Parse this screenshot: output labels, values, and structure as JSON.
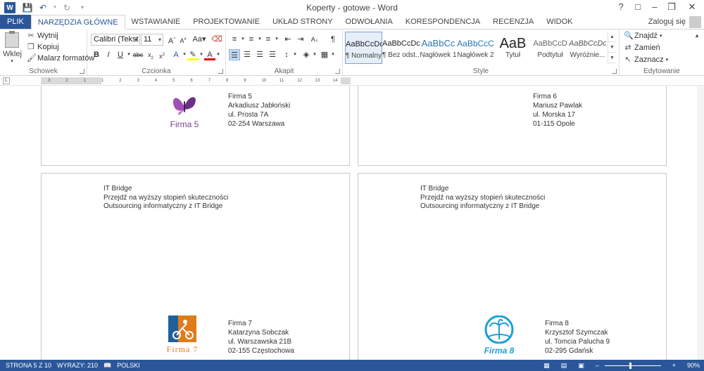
{
  "app": {
    "title": "Koperty - gotowe - Word",
    "signin": "Zaloguj się",
    "word_logo": "W"
  },
  "tabs": [
    {
      "label": "PLIK"
    },
    {
      "label": "NARZĘDZIA GŁÓWNE"
    },
    {
      "label": "WSTAWIANIE"
    },
    {
      "label": "PROJEKTOWANIE"
    },
    {
      "label": "UKŁAD STRONY"
    },
    {
      "label": "ODWOŁANIA"
    },
    {
      "label": "KORESPONDENCJA"
    },
    {
      "label": "RECENZJA"
    },
    {
      "label": "WIDOK"
    }
  ],
  "ribbon": {
    "clipboard": {
      "label": "Schowek",
      "paste": "Wklej",
      "cut": "Wytnij",
      "copy": "Kopiuj",
      "format_painter": "Malarz formatów"
    },
    "font": {
      "label": "Czcionka",
      "font_name": "Calibri (Tekst p",
      "font_size": "11"
    },
    "paragraph": {
      "label": "Akapit"
    },
    "styles": {
      "label": "Style",
      "items": [
        {
          "preview": "AaBbCcDc",
          "name": "¶ Normalny"
        },
        {
          "preview": "AaBbCcDc",
          "name": "¶ Bez odst..."
        },
        {
          "preview": "AaBbCc",
          "name": "Nagłówek 1"
        },
        {
          "preview": "AaBbCcC",
          "name": "Nagłówek 2"
        },
        {
          "preview": "AaB",
          "name": "Tytuł"
        },
        {
          "preview": "AaBbCcD",
          "name": "Podtytuł"
        },
        {
          "preview": "AaBbCcDc",
          "name": "Wyróżnie..."
        }
      ]
    },
    "editing": {
      "label": "Edytowanie",
      "find": "Znajdź",
      "replace": "Zamień",
      "select": "Zaznacz"
    }
  },
  "ruler": {
    "numbers": [
      "3",
      "2",
      "1",
      "1",
      "2",
      "3",
      "4",
      "5",
      "6",
      "7",
      "8",
      "9",
      "10",
      "11",
      "12",
      "13",
      "14"
    ]
  },
  "envelopes": [
    {
      "recipient": [
        "Firma 5",
        "Arkadiusz Jabłoński",
        "ul. Prosta 7A",
        "02-254  Warszawa"
      ],
      "logo": "Firma 5"
    },
    {
      "recipient": [
        "Firma 6",
        "Mariusz Pawlak",
        "ul. Morska 17",
        "01-115  Opole"
      ]
    },
    {
      "sender": [
        "IT Bridge",
        "Przejdź na wyższy stopień skuteczności",
        "Outsourcing informatyczny z IT Bridge"
      ],
      "recipient": [
        "Firma 7",
        "Katarzyna Sobczak",
        "ul. Warszawska 21B",
        "02-155  Częstochowa"
      ],
      "logo": "Firma 7"
    },
    {
      "sender": [
        "IT Bridge",
        "Przejdź na wyższy stopień skuteczności",
        "Outsourcing informatyczny z IT Bridge"
      ],
      "recipient": [
        "Firma 8",
        "Krzysztof Szymczak",
        "ul. Tomcia Palucha 9",
        "02-295  Gdańsk"
      ],
      "logo": "Firma 8"
    }
  ],
  "status": {
    "page": "STRONA 5 Z 10",
    "words": "WYRAZY: 210",
    "language": "POLSKI",
    "zoom": "90%",
    "zoom_fraction": 0.45
  },
  "colors": {
    "accent": "#2b579a",
    "firma5": "#7b3f8f",
    "firma7": "#e07b1a",
    "firma8": "#1aa0d6"
  }
}
